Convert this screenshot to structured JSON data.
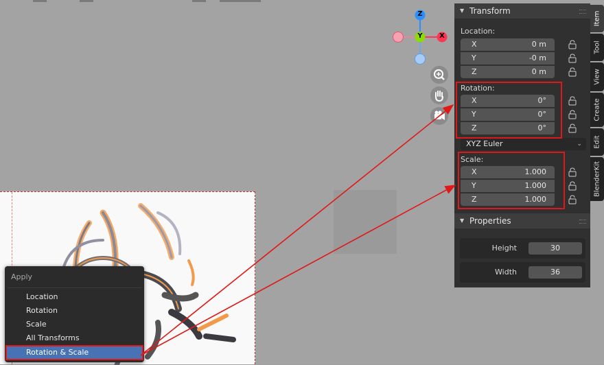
{
  "apply_menu": {
    "title": "Apply",
    "items": [
      "Location",
      "Rotation",
      "Scale",
      "All Transforms",
      "Rotation & Scale"
    ],
    "active_item": "Rotation & Scale"
  },
  "gizmo": {
    "z": "Z",
    "y": "Y",
    "x": "X"
  },
  "transform": {
    "title": "Transform",
    "location_label": "Location:",
    "location": [
      {
        "axis": "X",
        "value": "0 m"
      },
      {
        "axis": "Y",
        "value": "-0 m"
      },
      {
        "axis": "Z",
        "value": "0 m"
      }
    ],
    "rotation_label": "Rotation:",
    "rotation": [
      {
        "axis": "X",
        "value": "0°"
      },
      {
        "axis": "Y",
        "value": "0°"
      },
      {
        "axis": "Z",
        "value": "0°"
      }
    ],
    "rotation_mode": "XYZ Euler",
    "scale_label": "Scale:",
    "scale": [
      {
        "axis": "X",
        "value": "1.000"
      },
      {
        "axis": "Y",
        "value": "1.000"
      },
      {
        "axis": "Z",
        "value": "1.000"
      }
    ]
  },
  "properties": {
    "title": "Properties",
    "height_label": "Height",
    "height_value": "30",
    "width_label": "Width",
    "width_value": "36"
  },
  "tabs": [
    "Item",
    "Tool",
    "View",
    "Create",
    "Edit",
    "BlenderKit"
  ],
  "active_tab": "Item",
  "colors": {
    "highlight": "#e01818",
    "menu_active": "#4772b3",
    "axis_x": "#ff3352",
    "axis_y": "#8bdc00",
    "axis_z": "#2890ff",
    "outline": "#f29a4a"
  }
}
